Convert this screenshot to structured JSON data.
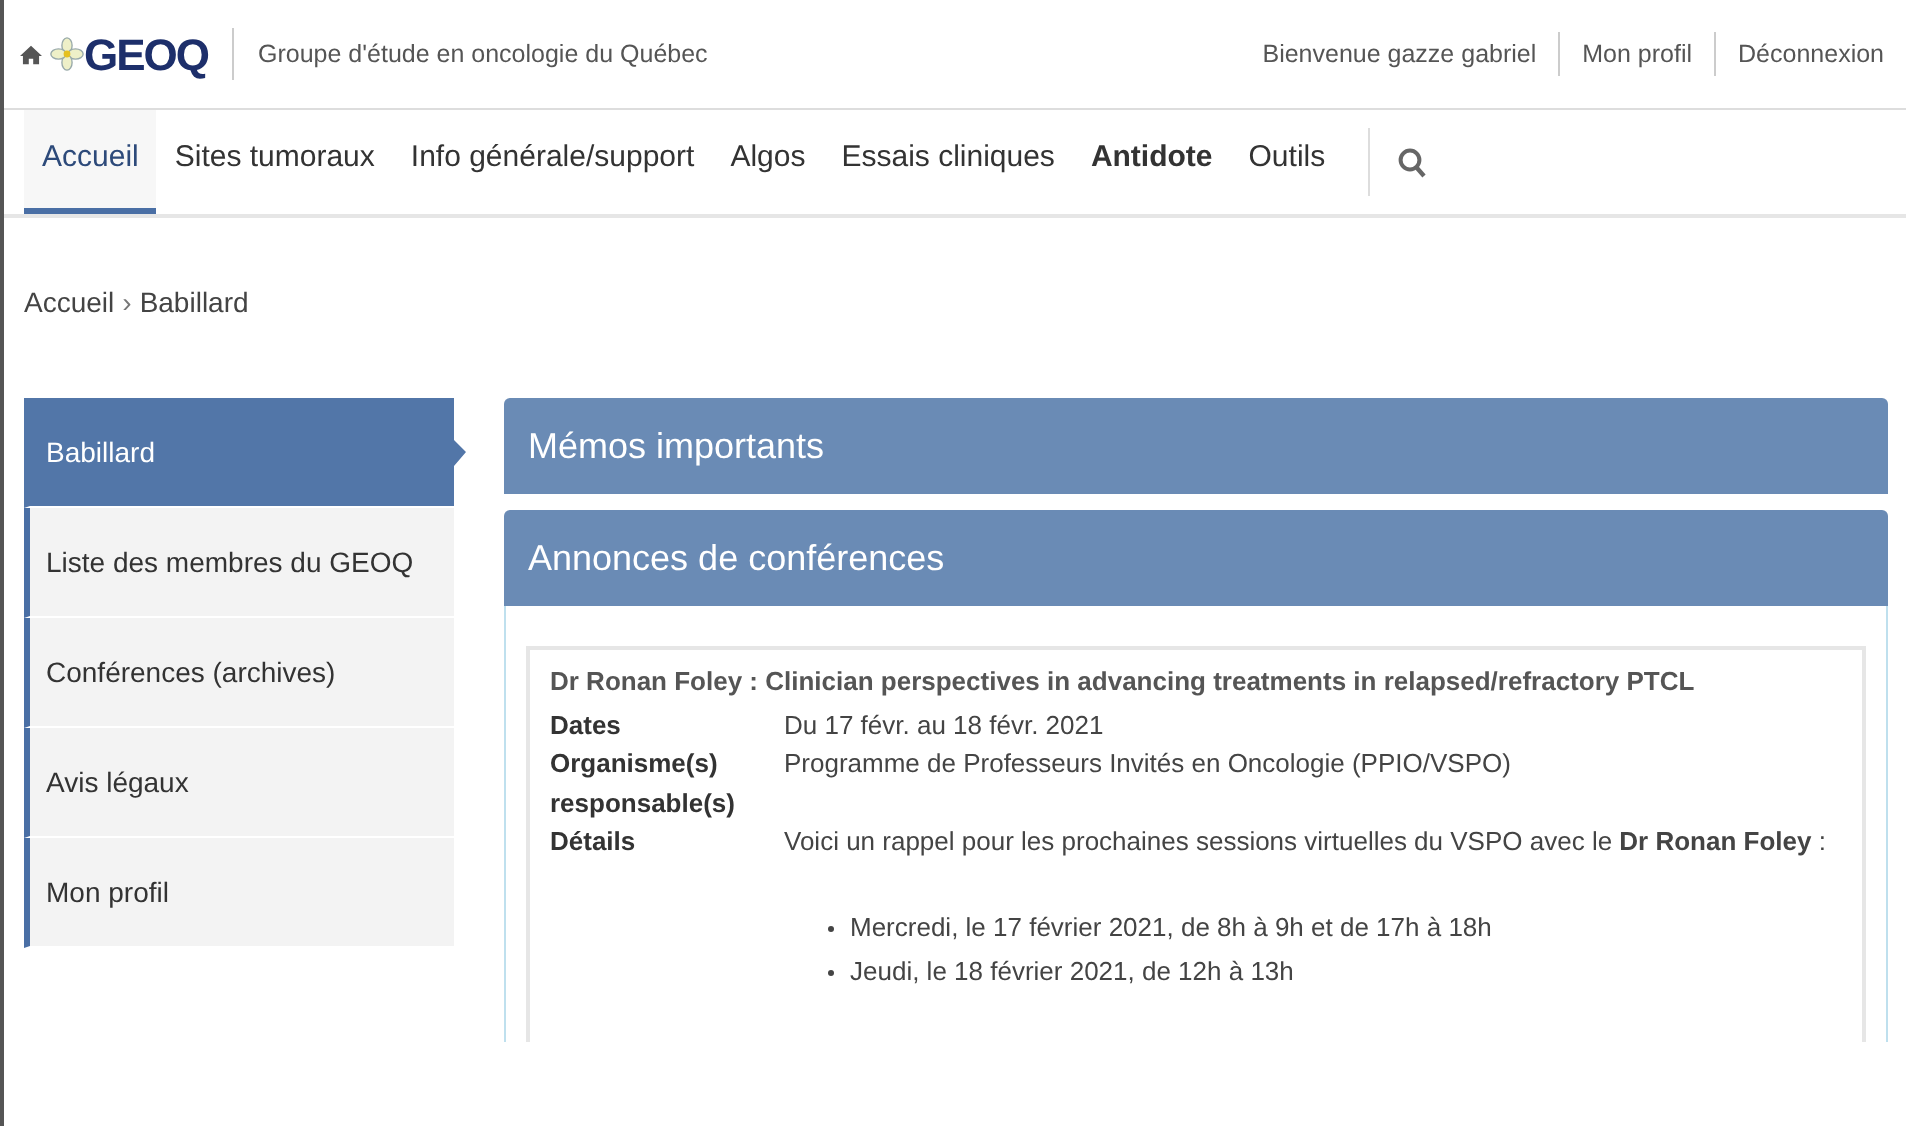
{
  "header": {
    "logo": "GEOQ",
    "org_name": "Groupe d'étude en oncologie du Québec",
    "user_links": [
      "Bienvenue gazze gabriel",
      "Mon profil",
      "Déconnexion"
    ]
  },
  "nav": [
    {
      "label": "Accueil",
      "selected": true,
      "bold": false
    },
    {
      "label": "Sites tumoraux",
      "selected": false,
      "bold": false
    },
    {
      "label": "Info générale/support",
      "selected": false,
      "bold": false
    },
    {
      "label": "Algos",
      "selected": false,
      "bold": false
    },
    {
      "label": "Essais cliniques",
      "selected": false,
      "bold": false
    },
    {
      "label": "Antidote",
      "selected": false,
      "bold": true
    },
    {
      "label": "Outils",
      "selected": false,
      "bold": false
    }
  ],
  "breadcrumb": {
    "separator": "›",
    "items": [
      "Accueil",
      "Babillard"
    ]
  },
  "sidebar": {
    "items": [
      {
        "label": "Babillard",
        "selected": true
      },
      {
        "label": "Liste des membres du GEOQ",
        "selected": false
      },
      {
        "label": "Conférences (archives)",
        "selected": false
      },
      {
        "label": "Avis légaux",
        "selected": false
      },
      {
        "label": "Mon profil",
        "selected": false
      }
    ]
  },
  "panels": [
    {
      "title": "Mémos importants"
    },
    {
      "title": "Annonces de conférences"
    }
  ],
  "announcement": {
    "title": "Dr Ronan Foley : Clinician perspectives in advancing treatments in relapsed/refractory PTCL",
    "fields": [
      {
        "label": "Dates",
        "value": "Du 17 févr. au 18 févr. 2021"
      },
      {
        "label": "Organisme(s) responsable(s)",
        "value": "Programme de Professeurs Invités en Oncologie (PPIO/VSPO)"
      },
      {
        "label": "Détails",
        "value": "Voici un rappel pour les prochaines sessions virtuelles du VSPO avec le **Dr Ronan Foley** :",
        "bullets": [
          "Mercredi, le 17 février 2021, de 8h à 9h et de 17h à 18h",
          "Jeudi, le 18 février 2021, de 12h à 13h"
        ]
      }
    ]
  }
}
